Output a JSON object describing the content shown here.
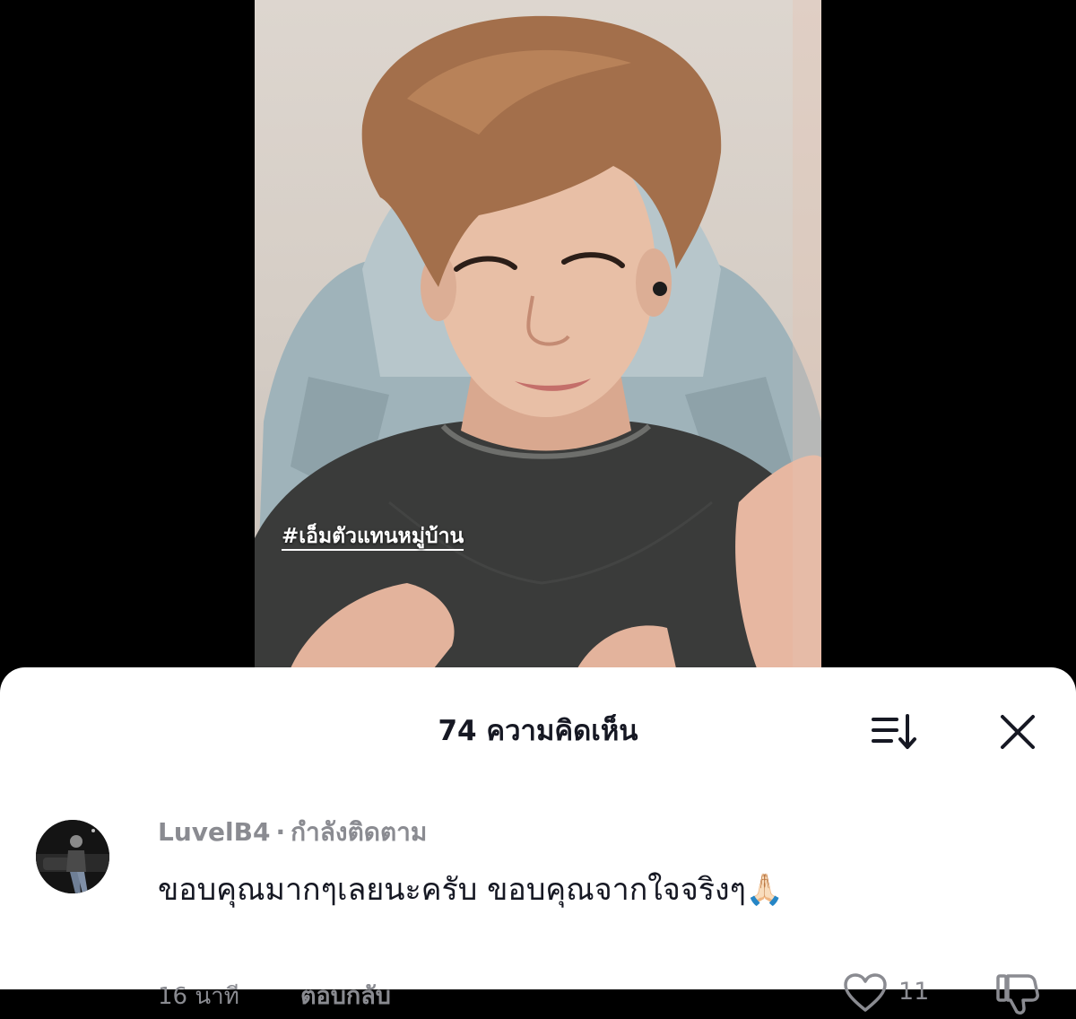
{
  "video": {
    "hashtag": "#เอ็มตัวแทนหมู่บ้าน"
  },
  "comments_panel": {
    "title": "74 ความคิดเห็น",
    "sort_icon": "sort-descending-icon",
    "close_icon": "close-icon"
  },
  "comment": {
    "username": "LuvelB4",
    "separator": "·",
    "status": "กำลังติดตาม",
    "text": "ขอบคุณมากๆเลยนะครับ ขอบคุณจากใจจริงๆ🙏🏻",
    "time": "16 นาที",
    "reply_label": "ตอบกลับ",
    "like_count": "11",
    "like_icon": "heart-outline-icon",
    "dislike_icon": "thumbs-down-icon"
  },
  "colors": {
    "text_primary": "#161823",
    "text_secondary": "#8a8b91",
    "sheet_background": "#ffffff",
    "backdrop": "#000000"
  }
}
